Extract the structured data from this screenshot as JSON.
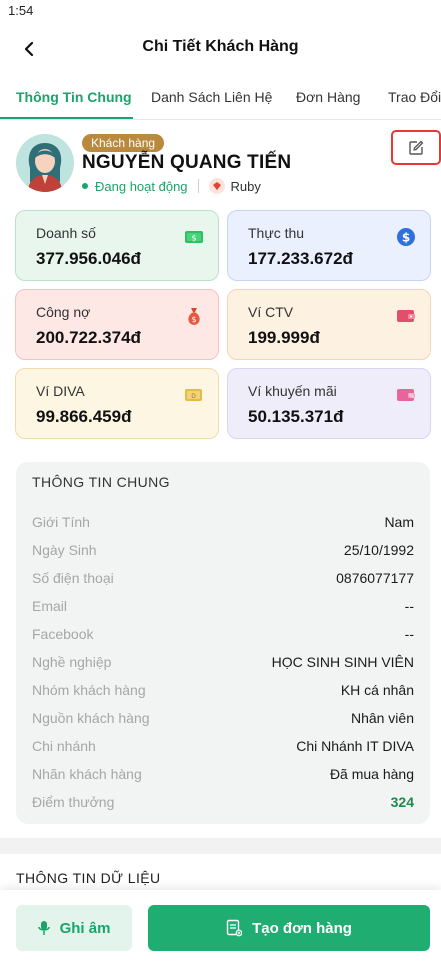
{
  "status_bar": {
    "time": "1:54"
  },
  "header": {
    "title": "Chi Tiết Khách Hàng"
  },
  "tabs": [
    {
      "label": "Thông Tin Chung",
      "active": true
    },
    {
      "label": "Danh Sách Liên Hệ",
      "active": false
    },
    {
      "label": "Đơn Hàng",
      "active": false
    },
    {
      "label": "Trao Đổi",
      "active": false
    }
  ],
  "profile": {
    "badge": "Khách hàng",
    "name": "NGUYỄN QUANG TIẾN",
    "status": "Đang hoạt động",
    "rank": "Ruby"
  },
  "stats": [
    {
      "label": "Doanh số",
      "value": "377.956.046đ",
      "bg": "#e8f6ee",
      "border": "#b9e3c9",
      "icon": "cash-icon"
    },
    {
      "label": "Thực thu",
      "value": "177.233.672đ",
      "bg": "#eaf0fd",
      "border": "#c6d4f4",
      "icon": "dollar-coin-icon"
    },
    {
      "label": "Công nợ",
      "value": "200.722.374đ",
      "bg": "#fde8e6",
      "border": "#f3c3bd",
      "icon": "money-bag-icon"
    },
    {
      "label": "Ví CTV",
      "value": "199.999đ",
      "bg": "#fdf1e2",
      "border": "#f1d6b1",
      "icon": "wallet-icon"
    },
    {
      "label": "Ví DIVA",
      "value": "99.866.459đ",
      "bg": "#fdf6e3",
      "border": "#efdca8",
      "icon": "wallet-diva-icon"
    },
    {
      "label": "Ví khuyến mãi",
      "value": "50.135.371đ",
      "bg": "#efedfa",
      "border": "#d8d4f2",
      "icon": "promo-wallet-icon"
    }
  ],
  "general_info": {
    "title": "THÔNG TIN CHUNG",
    "rows": [
      {
        "label": "Giới Tính",
        "value": "Nam"
      },
      {
        "label": "Ngày Sinh",
        "value": "25/10/1992"
      },
      {
        "label": "Số điện thoại",
        "value": "0876077177"
      },
      {
        "label": "Email",
        "value": "--"
      },
      {
        "label": "Facebook",
        "value": "--"
      },
      {
        "label": "Nghề nghiệp",
        "value": "HỌC SINH SINH VIÊN"
      },
      {
        "label": "Nhóm khách hàng",
        "value": "KH cá nhân"
      },
      {
        "label": "Nguồn khách hàng",
        "value": "Nhân viên"
      },
      {
        "label": "Chi nhánh",
        "value": "Chi Nhánh IT DIVA"
      },
      {
        "label": "Nhãn khách hàng",
        "value": "Đã mua hàng"
      },
      {
        "label": "Điểm thưởng",
        "value": "324",
        "highlight": true
      }
    ]
  },
  "data_section": {
    "title": "THÔNG TIN DỮ LIỆU"
  },
  "actions": {
    "record": "Ghi âm",
    "create_order": "Tạo đơn hàng"
  },
  "colors": {
    "accent": "#1aa36a",
    "badge": "#b98a3e",
    "edit_outline": "#e53935"
  }
}
